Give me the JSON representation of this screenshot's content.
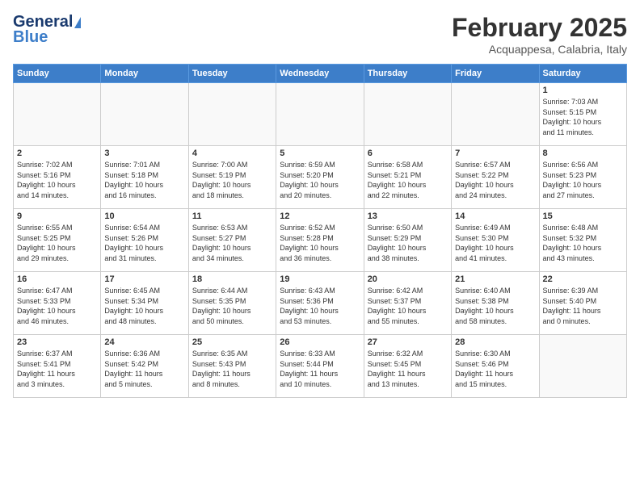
{
  "header": {
    "logo_general": "General",
    "logo_blue": "Blue",
    "title": "February 2025",
    "location": "Acquappesa, Calabria, Italy"
  },
  "days_of_week": [
    "Sunday",
    "Monday",
    "Tuesday",
    "Wednesday",
    "Thursday",
    "Friday",
    "Saturday"
  ],
  "weeks": [
    [
      {
        "day": "",
        "info": ""
      },
      {
        "day": "",
        "info": ""
      },
      {
        "day": "",
        "info": ""
      },
      {
        "day": "",
        "info": ""
      },
      {
        "day": "",
        "info": ""
      },
      {
        "day": "",
        "info": ""
      },
      {
        "day": "1",
        "info": "Sunrise: 7:03 AM\nSunset: 5:15 PM\nDaylight: 10 hours\nand 11 minutes."
      }
    ],
    [
      {
        "day": "2",
        "info": "Sunrise: 7:02 AM\nSunset: 5:16 PM\nDaylight: 10 hours\nand 14 minutes."
      },
      {
        "day": "3",
        "info": "Sunrise: 7:01 AM\nSunset: 5:18 PM\nDaylight: 10 hours\nand 16 minutes."
      },
      {
        "day": "4",
        "info": "Sunrise: 7:00 AM\nSunset: 5:19 PM\nDaylight: 10 hours\nand 18 minutes."
      },
      {
        "day": "5",
        "info": "Sunrise: 6:59 AM\nSunset: 5:20 PM\nDaylight: 10 hours\nand 20 minutes."
      },
      {
        "day": "6",
        "info": "Sunrise: 6:58 AM\nSunset: 5:21 PM\nDaylight: 10 hours\nand 22 minutes."
      },
      {
        "day": "7",
        "info": "Sunrise: 6:57 AM\nSunset: 5:22 PM\nDaylight: 10 hours\nand 24 minutes."
      },
      {
        "day": "8",
        "info": "Sunrise: 6:56 AM\nSunset: 5:23 PM\nDaylight: 10 hours\nand 27 minutes."
      }
    ],
    [
      {
        "day": "9",
        "info": "Sunrise: 6:55 AM\nSunset: 5:25 PM\nDaylight: 10 hours\nand 29 minutes."
      },
      {
        "day": "10",
        "info": "Sunrise: 6:54 AM\nSunset: 5:26 PM\nDaylight: 10 hours\nand 31 minutes."
      },
      {
        "day": "11",
        "info": "Sunrise: 6:53 AM\nSunset: 5:27 PM\nDaylight: 10 hours\nand 34 minutes."
      },
      {
        "day": "12",
        "info": "Sunrise: 6:52 AM\nSunset: 5:28 PM\nDaylight: 10 hours\nand 36 minutes."
      },
      {
        "day": "13",
        "info": "Sunrise: 6:50 AM\nSunset: 5:29 PM\nDaylight: 10 hours\nand 38 minutes."
      },
      {
        "day": "14",
        "info": "Sunrise: 6:49 AM\nSunset: 5:30 PM\nDaylight: 10 hours\nand 41 minutes."
      },
      {
        "day": "15",
        "info": "Sunrise: 6:48 AM\nSunset: 5:32 PM\nDaylight: 10 hours\nand 43 minutes."
      }
    ],
    [
      {
        "day": "16",
        "info": "Sunrise: 6:47 AM\nSunset: 5:33 PM\nDaylight: 10 hours\nand 46 minutes."
      },
      {
        "day": "17",
        "info": "Sunrise: 6:45 AM\nSunset: 5:34 PM\nDaylight: 10 hours\nand 48 minutes."
      },
      {
        "day": "18",
        "info": "Sunrise: 6:44 AM\nSunset: 5:35 PM\nDaylight: 10 hours\nand 50 minutes."
      },
      {
        "day": "19",
        "info": "Sunrise: 6:43 AM\nSunset: 5:36 PM\nDaylight: 10 hours\nand 53 minutes."
      },
      {
        "day": "20",
        "info": "Sunrise: 6:42 AM\nSunset: 5:37 PM\nDaylight: 10 hours\nand 55 minutes."
      },
      {
        "day": "21",
        "info": "Sunrise: 6:40 AM\nSunset: 5:38 PM\nDaylight: 10 hours\nand 58 minutes."
      },
      {
        "day": "22",
        "info": "Sunrise: 6:39 AM\nSunset: 5:40 PM\nDaylight: 11 hours\nand 0 minutes."
      }
    ],
    [
      {
        "day": "23",
        "info": "Sunrise: 6:37 AM\nSunset: 5:41 PM\nDaylight: 11 hours\nand 3 minutes."
      },
      {
        "day": "24",
        "info": "Sunrise: 6:36 AM\nSunset: 5:42 PM\nDaylight: 11 hours\nand 5 minutes."
      },
      {
        "day": "25",
        "info": "Sunrise: 6:35 AM\nSunset: 5:43 PM\nDaylight: 11 hours\nand 8 minutes."
      },
      {
        "day": "26",
        "info": "Sunrise: 6:33 AM\nSunset: 5:44 PM\nDaylight: 11 hours\nand 10 minutes."
      },
      {
        "day": "27",
        "info": "Sunrise: 6:32 AM\nSunset: 5:45 PM\nDaylight: 11 hours\nand 13 minutes."
      },
      {
        "day": "28",
        "info": "Sunrise: 6:30 AM\nSunset: 5:46 PM\nDaylight: 11 hours\nand 15 minutes."
      },
      {
        "day": "",
        "info": ""
      }
    ]
  ]
}
